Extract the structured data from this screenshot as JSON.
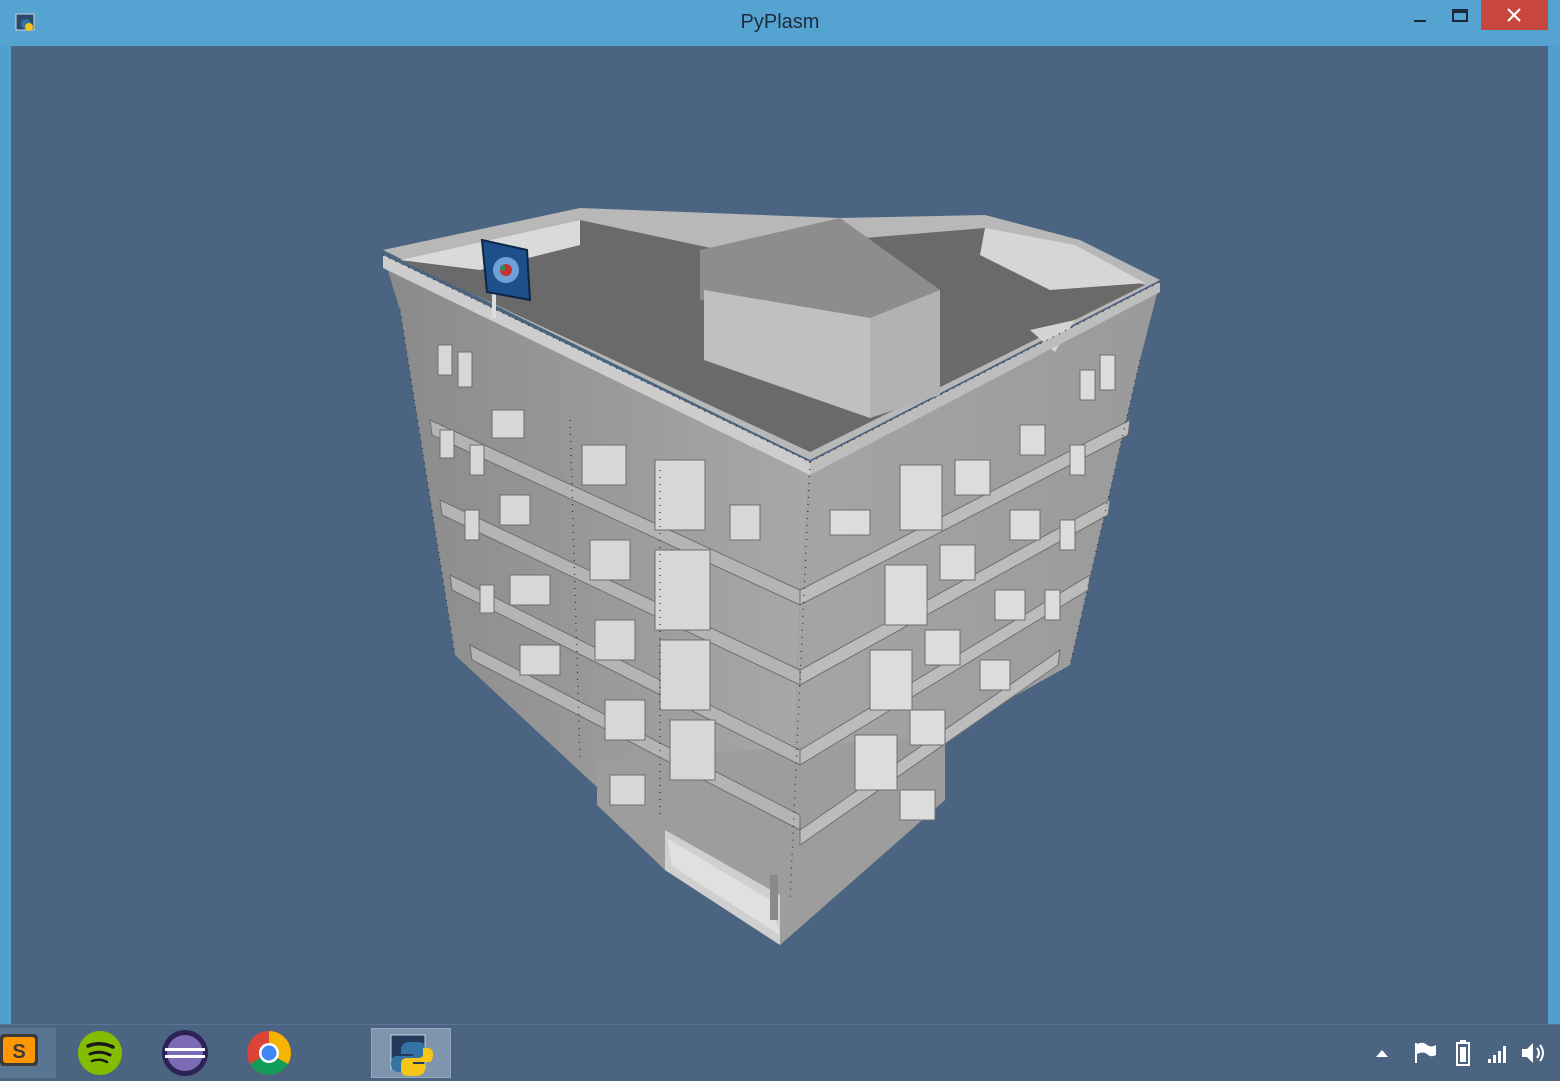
{
  "window": {
    "title": "PyPlasm",
    "buttons": {
      "minimize": "minimize-icon",
      "maximize": "maximize-icon",
      "close": "close-icon"
    }
  },
  "viewport": {
    "background_color": "#4a6482",
    "scene": "3d-building-model"
  },
  "taskbar": {
    "apps": [
      {
        "name": "sublime-text-icon",
        "active": false
      },
      {
        "name": "spotify-icon",
        "active": false
      },
      {
        "name": "eclipse-icon",
        "active": false
      },
      {
        "name": "chrome-icon",
        "active": false
      },
      {
        "name": "pyplasm-python-icon",
        "active": true
      }
    ],
    "tray": [
      "show-hidden-icons-icon",
      "action-center-flag-icon",
      "battery-icon",
      "network-signal-icon",
      "volume-icon"
    ]
  },
  "colors": {
    "titlebar": "#55a3d1",
    "close_button": "#c7463d",
    "taskbar": "#4a6482"
  }
}
